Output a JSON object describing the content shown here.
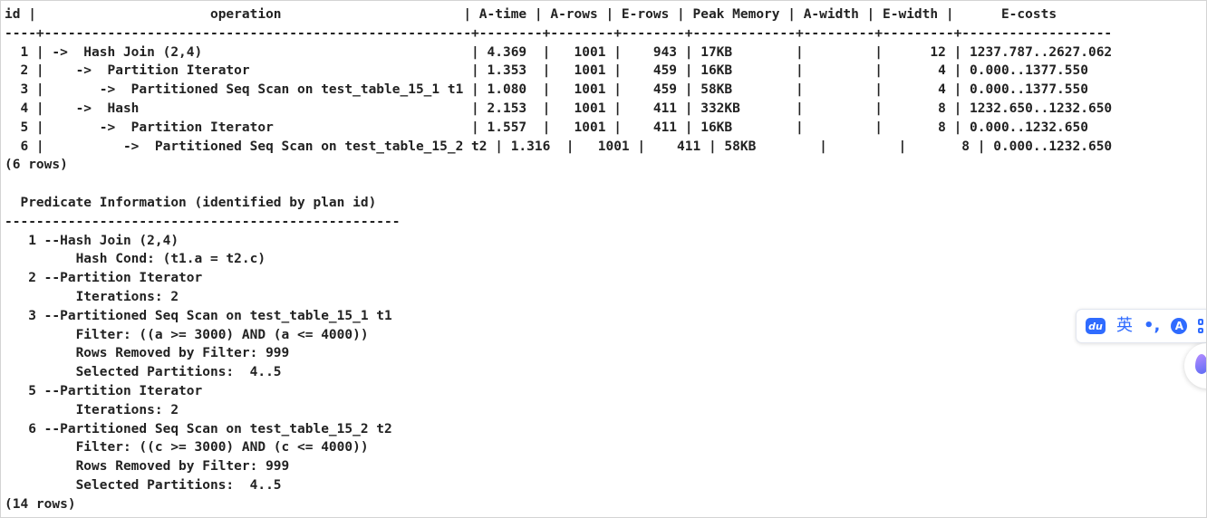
{
  "output": {
    "plan_header": "id |                      operation                       | A-time | A-rows | E-rows | Peak Memory | A-width | E-width |      E-costs",
    "plan_separator": "----+------------------------------------------------------+--------+--------+--------+-------------+---------+---------+-------------------",
    "plan_rows": [
      "  1 | ->  Hash Join (2,4)                                  | 4.369  |   1001 |    943 | 17KB        |         |      12 | 1237.787..2627.062",
      "  2 |    ->  Partition Iterator                            | 1.353  |   1001 |    459 | 16KB        |         |       4 | 0.000..1377.550",
      "  3 |       ->  Partitioned Seq Scan on test_table_15_1 t1 | 1.080  |   1001 |    459 | 58KB        |         |       4 | 0.000..1377.550",
      "  4 |    ->  Hash                                          | 2.153  |   1001 |    411 | 332KB       |         |       8 | 1232.650..1232.650",
      "  5 |       ->  Partition Iterator                         | 1.557  |   1001 |    411 | 16KB        |         |       8 | 0.000..1232.650",
      "  6 |          ->  Partitioned Seq Scan on test_table_15_2 t2 | 1.316  |   1001 |    411 | 58KB        |         |       8 | 0.000..1232.650"
    ],
    "plan_row_count": "(6 rows)",
    "blank": "",
    "predicate_title": "  Predicate Information (identified by plan id)",
    "predicate_separator": "--------------------------------------------------",
    "predicate_lines": [
      "   1 --Hash Join (2,4)",
      "         Hash Cond: (t1.a = t2.c)",
      "   2 --Partition Iterator",
      "         Iterations: 2",
      "   3 --Partitioned Seq Scan on test_table_15_1 t1",
      "         Filter: ((a >= 3000) AND (a <= 4000))",
      "         Rows Removed by Filter: 999",
      "         Selected Partitions:  4..5",
      "   5 --Partition Iterator",
      "         Iterations: 2",
      "   6 --Partitioned Seq Scan on test_table_15_2 t2",
      "         Filter: ((c >= 3000) AND (c <= 4000))",
      "         Rows Removed by Filter: 999",
      "         Selected Partitions:  4..5"
    ],
    "predicate_row_count": "(14 rows)"
  },
  "ime_toolbar": {
    "logo_text": "du",
    "language": "英",
    "punctuation": "•,",
    "font_icon_text": "A",
    "logo_icon": "baidu-ime-logo-icon",
    "grid_icon": "skin-grid-icon"
  },
  "floating_ball": {
    "icon": "assistant-drop-icon"
  }
}
